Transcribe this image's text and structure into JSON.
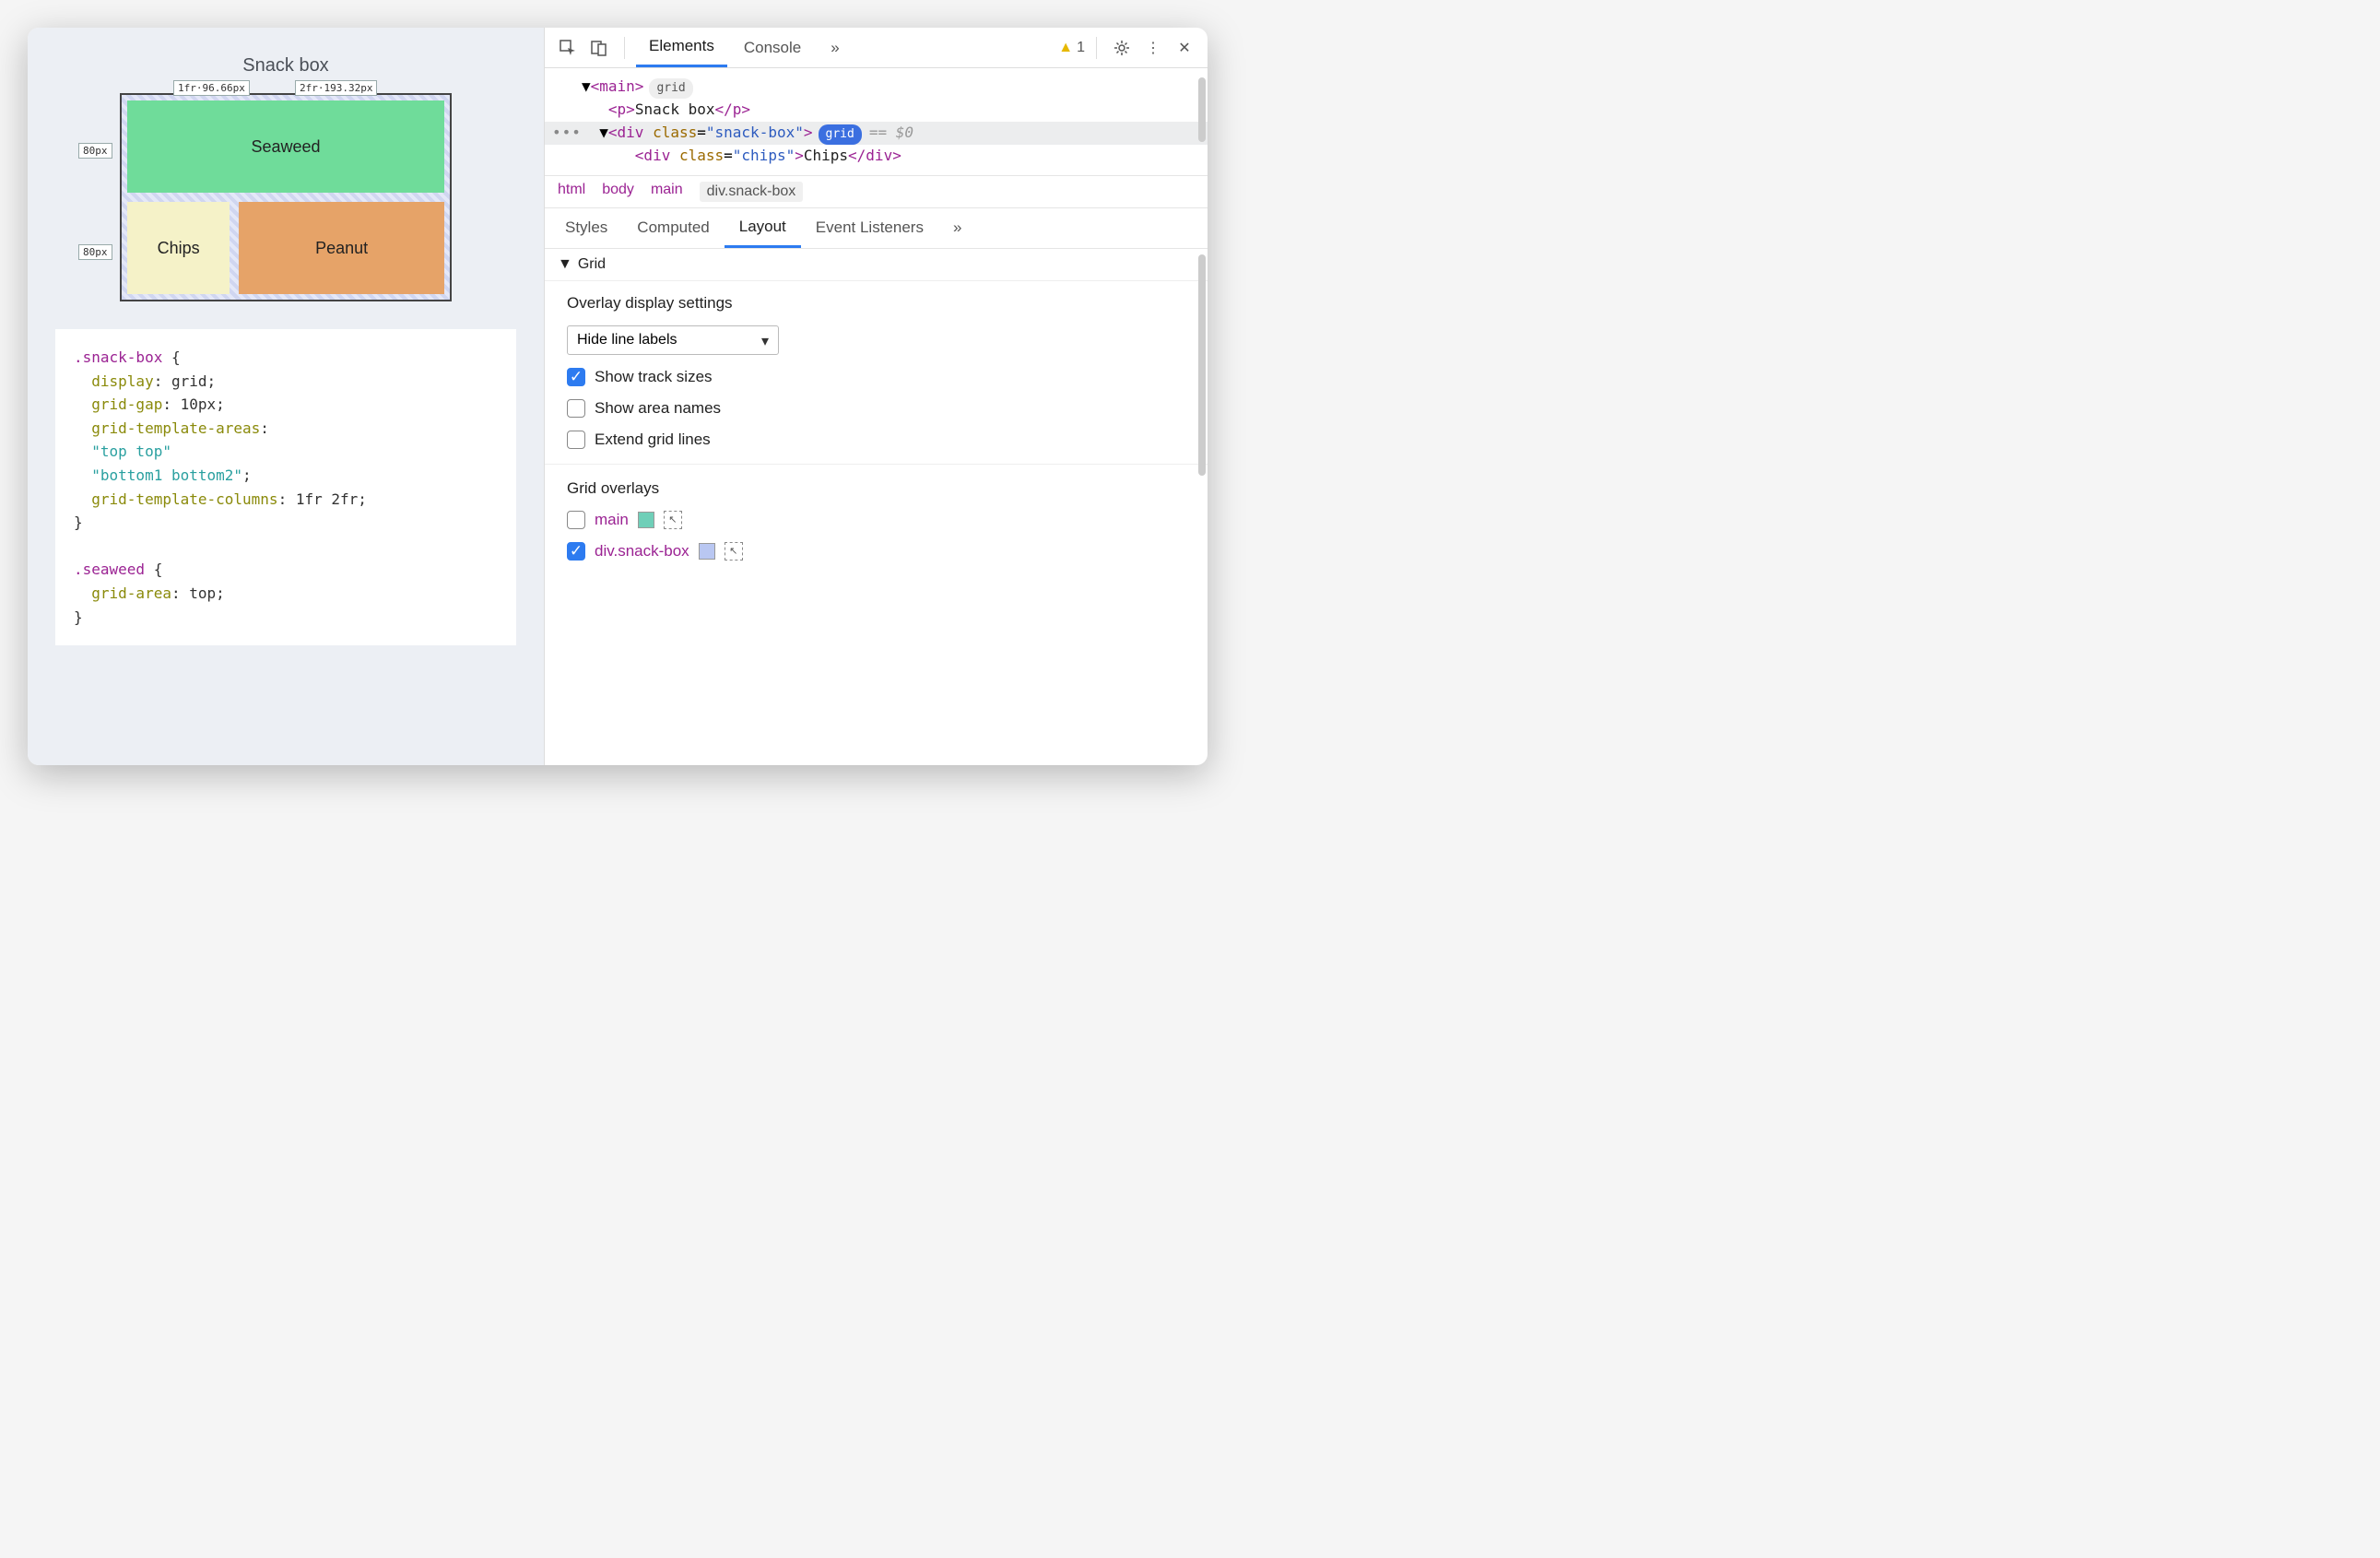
{
  "preview": {
    "title": "Snack box",
    "track_top1": "1fr·96.66px",
    "track_top2": "2fr·193.32px",
    "track_left1": "80px",
    "track_left2": "80px",
    "cells": {
      "seaweed": "Seaweed",
      "chips": "Chips",
      "peanut": "Peanut"
    },
    "css": {
      "sel1": ".snack-box",
      "l1a": "display",
      "l1b": "grid",
      "l2a": "grid-gap",
      "l2b": "10px",
      "l3a": "grid-template-areas",
      "l3b": "\"top top\"",
      "l3c": "\"bottom1 bottom2\"",
      "l4a": "grid-template-columns",
      "l4b": "1fr 2fr",
      "sel2": ".seaweed",
      "l5a": "grid-area",
      "l5b": "top"
    }
  },
  "toolbar": {
    "tabs": {
      "elements": "Elements",
      "console": "Console"
    },
    "more": "»",
    "warnings": "1"
  },
  "dom": {
    "main_open": "<main>",
    "main_pill": "grid",
    "p": "<p>Snack box</p>",
    "div_open_a": "<div ",
    "div_class": "class",
    "div_classval": "\"snack-box\"",
    "div_open_b": ">",
    "div_pill": "grid",
    "eq": "== $0",
    "chips": "<div class=\"chips\">Chips</div>"
  },
  "breadcrumb": {
    "html": "html",
    "body": "body",
    "main": "main",
    "cur": "div.snack-box"
  },
  "subtabs": {
    "styles": "Styles",
    "computed": "Computed",
    "layout": "Layout",
    "ev": "Event Listeners",
    "more": "»"
  },
  "layout": {
    "grid_hdr": "Grid",
    "overlay_title": "Overlay display settings",
    "select_label": "Hide line labels",
    "chk1": "Show track sizes",
    "chk2": "Show area names",
    "chk3": "Extend grid lines",
    "overlays_title": "Grid overlays",
    "ov1": "main",
    "ov2": "div.snack-box"
  }
}
